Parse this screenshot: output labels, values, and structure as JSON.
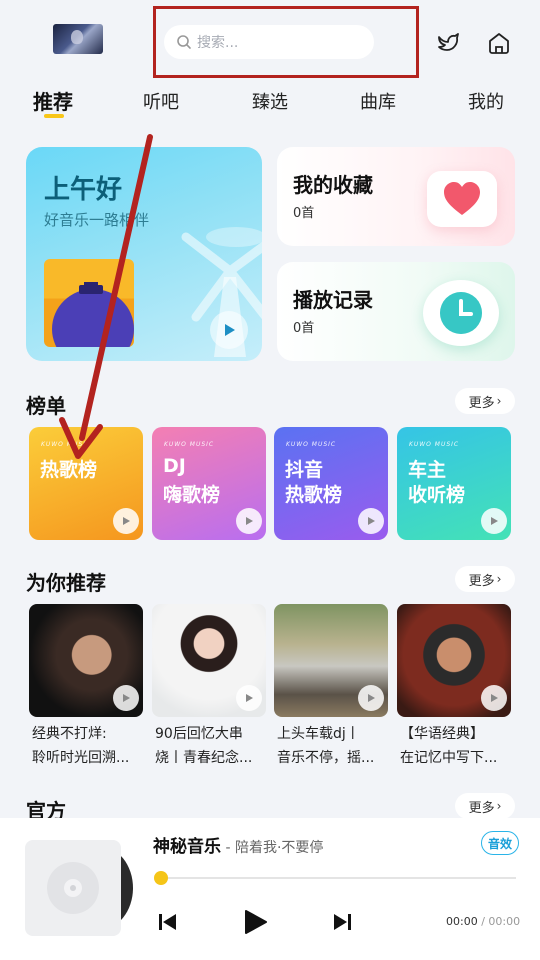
{
  "search": {
    "placeholder": "搜索..."
  },
  "tabs": [
    {
      "label": "推荐"
    },
    {
      "label": "听吧"
    },
    {
      "label": "臻选"
    },
    {
      "label": "曲库"
    },
    {
      "label": "我的"
    }
  ],
  "greeting": {
    "title": "上午好",
    "subtitle": "好音乐一路相伴"
  },
  "favorites": {
    "title": "我的收藏",
    "count": "0首"
  },
  "history": {
    "title": "播放记录",
    "count": "0首"
  },
  "charts_section": {
    "title": "榜单",
    "more": "更多",
    "items": [
      {
        "brand": "KUWO MUSIC",
        "line1": "热歌榜",
        "line2": "",
        "color_from": "#f9c133",
        "color_to": "#f58f1c"
      },
      {
        "brand": "KUWO MUSIC",
        "line1": "DJ",
        "line2": "嗨歌榜",
        "color_from": "#f77fb4",
        "color_to": "#c06de8"
      },
      {
        "brand": "KUWO MUSIC",
        "line1": "抖音",
        "line2": "热歌榜",
        "color_from": "#5d73f0",
        "color_to": "#8e5ef0"
      },
      {
        "brand": "KUWO MUSIC",
        "line1": "车主",
        "line2": "收听榜",
        "color_from": "#34c8e0",
        "color_to": "#3fe0b8"
      }
    ]
  },
  "recommend_section": {
    "title": "为你推荐",
    "more": "更多",
    "items": [
      {
        "line1": "经典不打烊:",
        "line2": "聆听时光回溯..."
      },
      {
        "line1": "90后回忆大串",
        "line2": "烧丨青春纪念..."
      },
      {
        "line1": "上头车载dj丨",
        "line2": "音乐不停，摇..."
      },
      {
        "line1": "【华语经典】",
        "line2": "在记忆中写下..."
      }
    ]
  },
  "official_section": {
    "title": "官方",
    "more": "更多"
  },
  "player": {
    "song": "神秘音乐",
    "artist": " - 陪着我·不要停",
    "sfx": "音效",
    "current_time": "00:00",
    "total_time": "00:00",
    "progress": 0
  },
  "colors": {
    "accent": "#f8c619",
    "annotation": "#b3231f",
    "sfx": "#1a9fd8"
  }
}
